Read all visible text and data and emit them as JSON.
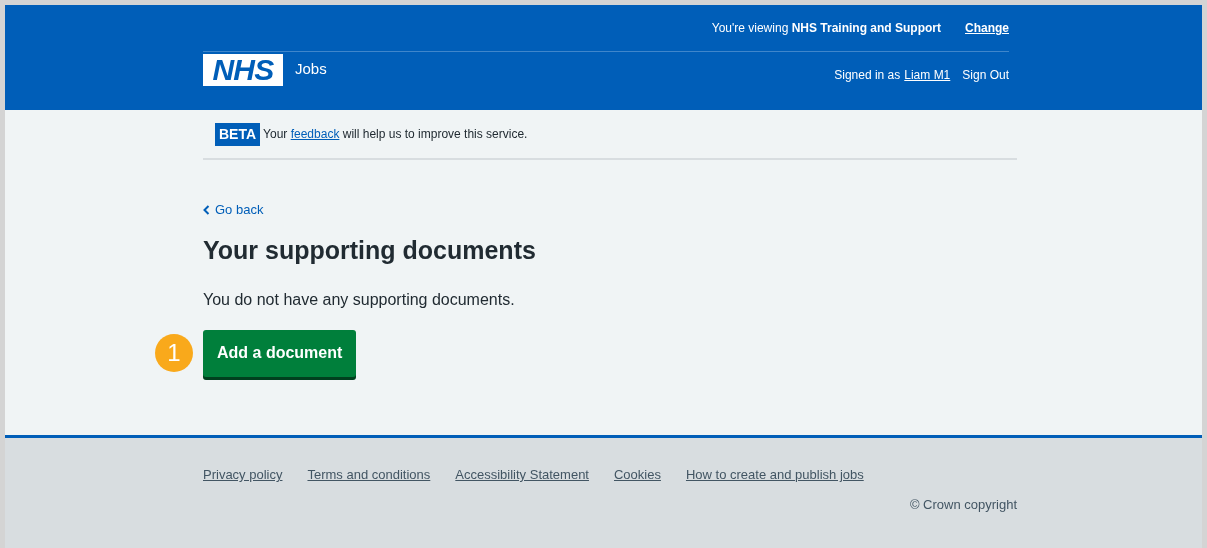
{
  "header": {
    "logo": "NHS",
    "service": "Jobs",
    "viewing": "You're viewing **NHS Training and Support**",
    "change_link": "Change",
    "signed_in_label": "Signed in as",
    "user_link": "Liam M1",
    "sign_out": "Sign Out"
  },
  "beta_banner": {
    "tag": "BETA",
    "text_before": "Your",
    "link": "feedback",
    "text_after": "will help us to improve this service."
  },
  "back_link": "Go back",
  "heading": "Your supporting documents",
  "body": "You do not have any supporting documents.",
  "button": {
    "label": "Add a document",
    "callout": "1"
  },
  "footer": {
    "links": [
      "Privacy policy",
      "Terms and conditions",
      "Accessibility Statement",
      "Cookies",
      "How to create and publish jobs"
    ],
    "copyright": "© Crown copyright"
  }
}
